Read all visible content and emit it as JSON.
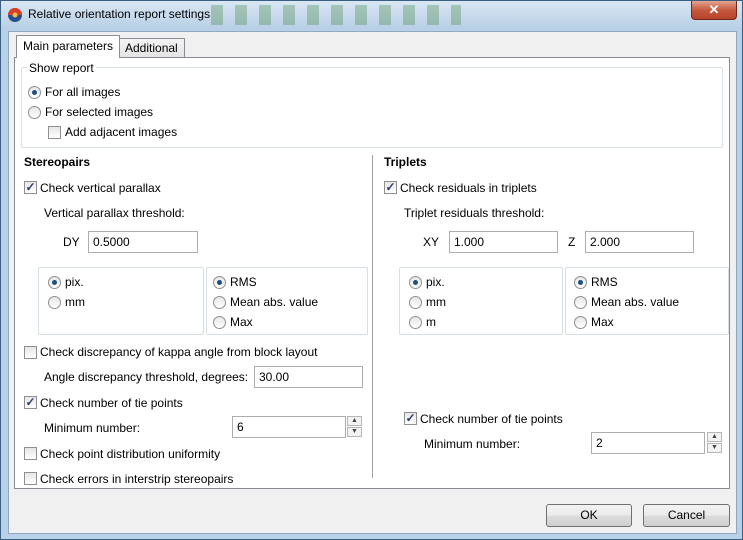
{
  "window": {
    "title": "Relative orientation report settings",
    "close_glyph": "✕"
  },
  "tabs": [
    {
      "label": "Main parameters",
      "active": true
    },
    {
      "label": "Additional",
      "active": false
    }
  ],
  "show_report": {
    "label": "Show report",
    "options": [
      {
        "label": "For all images",
        "selected": true
      },
      {
        "label": "For selected images",
        "selected": false
      }
    ],
    "add_adjacent": {
      "label": "Add adjacent images",
      "checked": false
    }
  },
  "stereopairs": {
    "heading": "Stereopairs",
    "check_vertical_parallax": {
      "label": "Check vertical parallax",
      "checked": true
    },
    "threshold_label": "Vertical parallax threshold:",
    "dy_label": "DY",
    "dy_value": "0.5000",
    "units": [
      {
        "label": "pix.",
        "selected": true
      },
      {
        "label": "mm",
        "selected": false
      }
    ],
    "stats": [
      {
        "label": "RMS",
        "selected": true
      },
      {
        "label": "Mean abs. value",
        "selected": false
      },
      {
        "label": "Max",
        "selected": false
      }
    ],
    "check_kappa": {
      "label": "Check discrepancy of kappa angle from block layout",
      "checked": false
    },
    "angle_label": "Angle discrepancy threshold, degrees:",
    "angle_value": "30.00",
    "check_tie_points": {
      "label": "Check number of tie points",
      "checked": true
    },
    "min_number_label": "Minimum number:",
    "min_number_value": "6",
    "check_distribution": {
      "label": "Check point distribution uniformity",
      "checked": false
    },
    "check_interstrip": {
      "label": "Check errors in interstrip stereopairs",
      "checked": false
    }
  },
  "triplets": {
    "heading": "Triplets",
    "check_residuals": {
      "label": "Check residuals in triplets",
      "checked": true
    },
    "threshold_label": "Triplet residuals threshold:",
    "xy_label": "XY",
    "xy_value": "1.000",
    "z_label": "Z",
    "z_value": "2.000",
    "units": [
      {
        "label": "pix.",
        "selected": true
      },
      {
        "label": "mm",
        "selected": false
      },
      {
        "label": "m",
        "selected": false
      }
    ],
    "stats": [
      {
        "label": "RMS",
        "selected": true
      },
      {
        "label": "Mean abs. value",
        "selected": false
      },
      {
        "label": "Max",
        "selected": false
      }
    ],
    "check_tie_points": {
      "label": "Check number of tie points",
      "checked": true
    },
    "min_number_label": "Minimum number:",
    "min_number_value": "2"
  },
  "buttons": {
    "ok": "OK",
    "cancel": "Cancel"
  },
  "spin_glyphs": {
    "up": "▲",
    "down": "▼"
  },
  "check_glyph": "✓"
}
